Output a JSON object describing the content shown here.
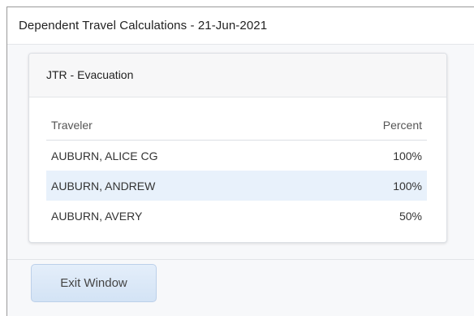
{
  "window": {
    "title": "Dependent Travel Calculations - 21-Jun-2021"
  },
  "card": {
    "title": "JTR - Evacuation",
    "columns": {
      "traveler": "Traveler",
      "percent": "Percent"
    },
    "rows": [
      {
        "traveler": "AUBURN, ALICE CG",
        "percent": "100%",
        "selected": false
      },
      {
        "traveler": "AUBURN, ANDREW",
        "percent": "100%",
        "selected": true
      },
      {
        "traveler": "AUBURN, AVERY",
        "percent": "50%",
        "selected": false
      }
    ]
  },
  "footer": {
    "exit_label": "Exit Window"
  },
  "colors": {
    "selected_row": "#e8f1fb",
    "button_bg": "#dbe8f7"
  }
}
